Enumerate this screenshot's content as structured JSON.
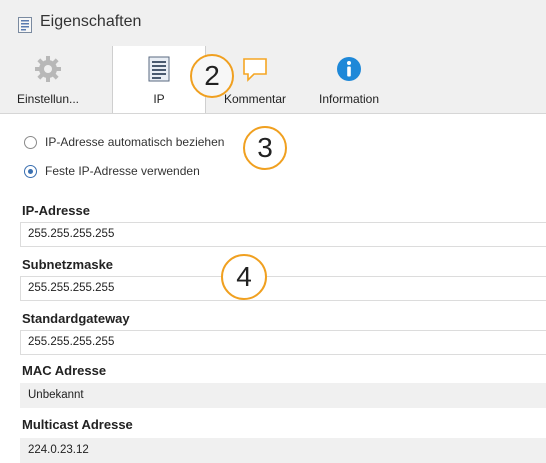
{
  "window": {
    "title": "Eigenschaften"
  },
  "tabs": [
    {
      "label": "Einstellun...",
      "icon": "gear-icon"
    },
    {
      "label": "IP",
      "icon": "network-list-icon",
      "active": true
    },
    {
      "label": "Kommentar",
      "icon": "comment-icon"
    },
    {
      "label": "Information",
      "icon": "info-icon"
    }
  ],
  "callouts": [
    "2",
    "3",
    "4"
  ],
  "ip_mode": {
    "options": [
      {
        "label": "IP-Adresse automatisch beziehen",
        "selected": false
      },
      {
        "label": "Feste IP-Adresse verwenden",
        "selected": true
      }
    ]
  },
  "fields": [
    {
      "label": "IP-Adresse",
      "value": "255.255.255.255",
      "editable": true
    },
    {
      "label": "Subnetzmaske",
      "value": "255.255.255.255",
      "editable": true
    },
    {
      "label": "Standardgateway",
      "value": "255.255.255.255",
      "editable": true
    },
    {
      "label": "MAC Adresse",
      "value": "Unbekannt",
      "editable": false
    },
    {
      "label": "Multicast Adresse",
      "value": "224.0.23.12",
      "editable": false
    }
  ],
  "colors": {
    "accent": "#3a6fb0",
    "callout": "#f0a020",
    "info_blue": "#1e88d8",
    "comment_orange": "#f5a623"
  }
}
